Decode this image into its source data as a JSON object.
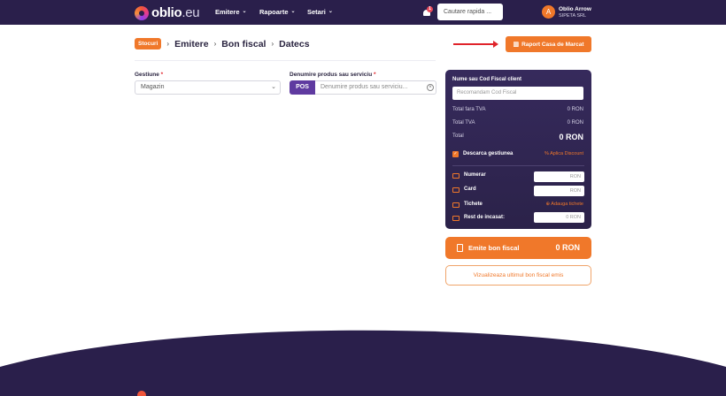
{
  "brand": {
    "logo_bold": "oblio",
    "logo_light": ".eu"
  },
  "nav": {
    "items": [
      {
        "label": "Emitere"
      },
      {
        "label": "Rapoarte"
      },
      {
        "label": "Setari"
      }
    ],
    "notifications_count": "1",
    "search_placeholder": "Cautare rapida ...",
    "user": {
      "initial": "A",
      "name": "Oblio Arrow",
      "company": "SIPETA SRL"
    }
  },
  "breadcrumb": {
    "pill": "Stocuri",
    "items": [
      "Emitere",
      "Bon fiscal",
      "Datecs"
    ]
  },
  "report_button": {
    "label": "Raport Casa de Marcat",
    "icon": "bar-chart-icon"
  },
  "form": {
    "gestiune_label": "Gestiune",
    "gestiune_value": "Magazin",
    "produs_label": "Denumire produs sau serviciu",
    "pos_label": "POS",
    "produs_placeholder": "Denumire produs sau serviciu...",
    "required_mark": "*"
  },
  "receipt": {
    "client_label": "Nume sau Cod Fiscal client",
    "client_placeholder": "Recomandam Cod Fiscal",
    "total_fara_tva_label": "Total fara TVA",
    "total_fara_tva_value": "0 RON",
    "total_tva_label": "Total TVA",
    "total_tva_value": "0 RON",
    "total_label": "Total",
    "total_value": "0 RON",
    "descarca_label": "Descarca gestiunea",
    "discount_link": "% Aplica Discount",
    "payments": [
      {
        "label": "Numerar",
        "value": "RON"
      },
      {
        "label": "Card",
        "value": "RON"
      },
      {
        "label": "Tichete",
        "link": "Adauga tichete"
      },
      {
        "label": "Rest de incasat:",
        "value": "0 RON"
      }
    ]
  },
  "emite_button": {
    "label": "Emite bon fiscal",
    "amount": "0 RON"
  },
  "view_last_button": {
    "label": "Vizualizeaza ultimul bon fiscal emis"
  },
  "colors": {
    "nav_bg": "#2a1f4b",
    "accent": "#f0782a",
    "panel_bg": "#2b2249",
    "pos": "#5f3aa0",
    "annotation_arrow": "#e0232a"
  }
}
